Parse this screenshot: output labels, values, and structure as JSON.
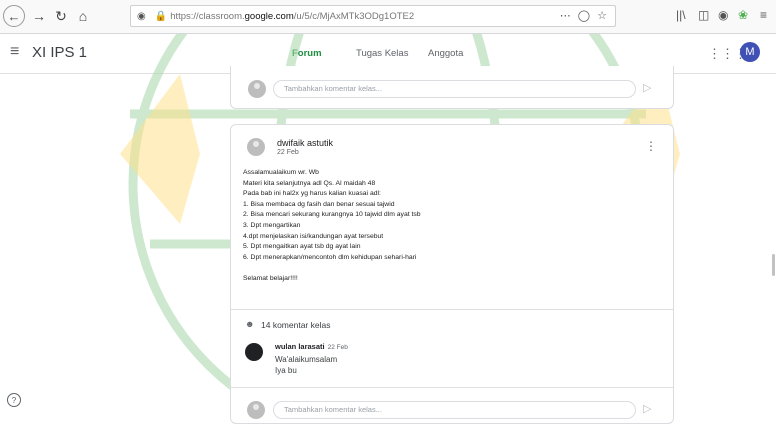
{
  "browser": {
    "url_prefix": "https://classroom.",
    "url_host": "google.com",
    "url_path": "/u/5/c/MjAxMTk3ODg1OTE2"
  },
  "app": {
    "class_title": "XI IPS 1",
    "tabs": [
      {
        "label": "Forum",
        "active": true
      },
      {
        "label": "Tugas Kelas",
        "active": false
      },
      {
        "label": "Anggota",
        "active": false
      }
    ],
    "avatar_letter": "M",
    "accent_color": "#1e8e3e"
  },
  "top_comment_placeholder": "Tambahkan komentar kelas...",
  "post": {
    "author": "dwifaik astutik",
    "date": "22 Feb",
    "lines": [
      "Assalamualaikum wr. Wb",
      "Materi kita selanjutnya adl Qs. Al maidah 48",
      "Pada bab ini hal2x yg harus kalian kuasai adl:",
      "1. Bisa membaca dg fasih dan benar sesuai tajwid",
      "2. Bisa mencari sekurang kurangnya 10 tajwid dlm ayat tsb",
      "3. Dpt mengartikan",
      "4.dpt menjelaskan isi/kandungan ayat tersebut",
      "5. Dpt mengaitkan ayat tsb dg ayat lain",
      "6. Dpt menerapkan/mencontoh dlm kehidupan sehari-hari",
      "",
      "Selamat belajar!!!!"
    ],
    "comment_count_label": "14 komentar kelas",
    "comment": {
      "author": "wulan larasati",
      "date": "22 Feb",
      "lines": [
        "Wa'alaikumsalam",
        "Iya bu"
      ]
    },
    "bottom_placeholder": "Tambahkan komentar kelas..."
  },
  "icons": {
    "back": "back-arrow-icon",
    "forward": "forward-arrow-icon",
    "reload": "reload-icon",
    "home": "home-icon",
    "menu": "hamburger-menu-icon",
    "apps": "apps-grid-icon",
    "help": "help-icon"
  }
}
